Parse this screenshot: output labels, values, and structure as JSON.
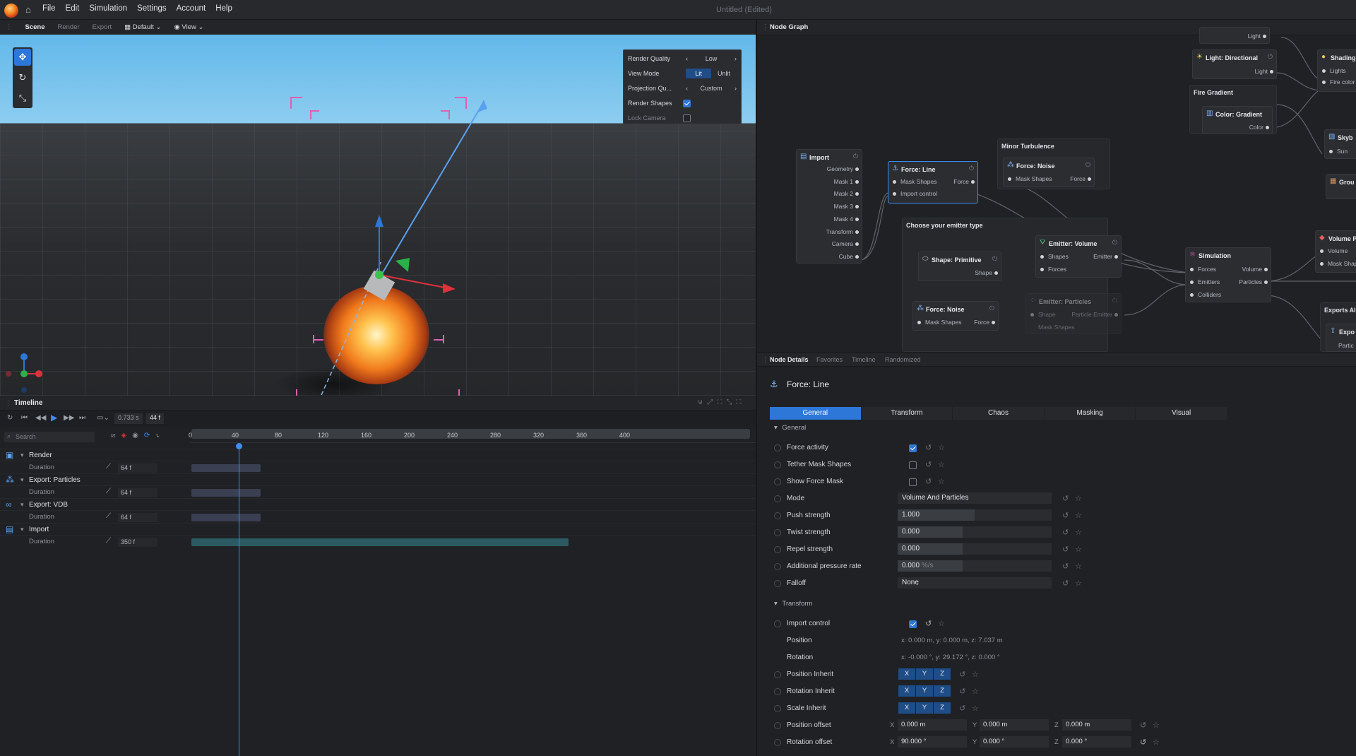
{
  "menubar": {
    "items": [
      "File",
      "Edit",
      "Simulation",
      "Settings",
      "Account",
      "Help"
    ],
    "title": "Untitled (Edited)"
  },
  "scenebar": {
    "tabs": [
      "Scene",
      "Render",
      "Export"
    ],
    "layout": "Default",
    "view": "View"
  },
  "render_panel": {
    "quality_label": "Render Quality",
    "quality_value": "Low",
    "viewmode_label": "View Mode",
    "viewmode_options": [
      "Lit",
      "Unlit"
    ],
    "viewmode_selected": "Lit",
    "projection_label": "Projection Qu...",
    "projection_value": "Custom",
    "shapes_label": "Render Shapes",
    "shapes_checked": true,
    "lock_label": "Lock Camera",
    "lock_checked": false
  },
  "timeline": {
    "title": "Timeline",
    "time": "0.733 s",
    "frame": "44 f",
    "search_placeholder": "Search",
    "ruler": [
      "0",
      "40",
      "80",
      "120",
      "160",
      "200",
      "240",
      "280",
      "320",
      "360",
      "400"
    ],
    "playhead_frame": 44,
    "tracks": [
      {
        "name": "Render",
        "sub": "Duration",
        "value": "64 f",
        "frames": 64
      },
      {
        "name": "Export: Particles",
        "sub": "Duration",
        "value": "64 f",
        "frames": 64
      },
      {
        "name": "Export: VDB",
        "sub": "Duration",
        "value": "64 f",
        "frames": 64
      },
      {
        "name": "Import",
        "sub": "Duration",
        "value": "350 f",
        "frames": 350
      }
    ]
  },
  "nodegraph": {
    "title": "Node Graph",
    "nodes": {
      "import": {
        "title": "Import",
        "pins": [
          "Geometry",
          "Mask 1",
          "Mask 2",
          "Mask 3",
          "Mask 4",
          "Transform",
          "Camera",
          "Cube"
        ]
      },
      "force_line": {
        "title": "Force: Line",
        "in1": "Mask Shapes",
        "out1": "Force",
        "in2": "Import control"
      },
      "minor_turbulence": {
        "title": "Minor Turbulence"
      },
      "force_noise_a": {
        "title": "Force: Noise",
        "in1": "Mask Shapes",
        "out1": "Force"
      },
      "emitter_group": {
        "title": "Choose your emitter type"
      },
      "shape_primitive": {
        "title": "Shape: Primitive",
        "out1": "Shape"
      },
      "emitter_volume": {
        "title": "Emitter: Volume",
        "in1": "Shapes",
        "out1": "Emitter",
        "in2": "Forces"
      },
      "force_noise_b": {
        "title": "Force: Noise",
        "in1": "Mask Shapes",
        "out1": "Force"
      },
      "emitter_particles": {
        "title": "Emitter: Particles",
        "in1": "Shape",
        "out1": "Particle Emitter",
        "in2": "Mask Shapes"
      },
      "simulation": {
        "title": "Simulation",
        "in": [
          "Forces",
          "Emitters",
          "Colliders"
        ],
        "out": [
          "Volume",
          "Particles"
        ]
      },
      "light_top": {
        "out1": "Light"
      },
      "light_dir": {
        "title": "Light: Directional",
        "out1": "Light"
      },
      "fire_gradient": {
        "title": "Fire Gradient"
      },
      "color_gradient": {
        "title": "Color: Gradient",
        "out1": "Color"
      },
      "shading": {
        "title": "Shading",
        "in": [
          "Lights",
          "Fire color"
        ]
      },
      "skybox": {
        "title": "Skyb",
        "in1": "Sun"
      },
      "ground": {
        "title": "Grou"
      },
      "volume": {
        "title": "Volume P",
        "in": [
          "Volume",
          "Mask Shap"
        ]
      },
      "exports": {
        "title": "Exports Ale",
        "node": "Expo",
        "in1": "Partic"
      }
    }
  },
  "details": {
    "tabs": [
      "Node Details",
      "Favorites",
      "Timeline",
      "Randomized"
    ],
    "node_title": "Force: Line",
    "prop_tabs": [
      "General",
      "Transform",
      "Chaos",
      "Masking",
      "Visual"
    ],
    "general_title": "General",
    "transform_title": "Transform",
    "force_activity": {
      "label": "Force activity",
      "checked": true
    },
    "tether": {
      "label": "Tether Mask Shapes",
      "checked": false
    },
    "show_mask": {
      "label": "Show Force Mask",
      "checked": false
    },
    "mode": {
      "label": "Mode",
      "value": "Volume And Particles"
    },
    "push": {
      "label": "Push strength",
      "value": "1.000",
      "fill": 0.5
    },
    "twist": {
      "label": "Twist strength",
      "value": "0.000",
      "fill": 0.42
    },
    "repel": {
      "label": "Repel strength",
      "value": "0.000",
      "fill": 0.42
    },
    "pressure": {
      "label": "Additional pressure rate",
      "value": "0.000",
      "unit": "%/s",
      "fill": 0.42
    },
    "falloff": {
      "label": "Falloff",
      "value": "None"
    },
    "import_control": {
      "label": "Import control",
      "checked": true
    },
    "position": {
      "label": "Position",
      "value": "x: 0.000 m, y: 0.000 m, z: 7.037 m"
    },
    "rotation": {
      "label": "Rotation",
      "value": "x: -0.000 °, y: 29.172 °, z: 0.000 °"
    },
    "position_inherit": {
      "label": "Position Inherit"
    },
    "rotation_inherit": {
      "label": "Rotation Inherit"
    },
    "scale_inherit": {
      "label": "Scale Inherit"
    },
    "xyz": [
      "X",
      "Y",
      "Z"
    ],
    "position_offset": {
      "label": "Position offset",
      "x": "0.000 m",
      "y": "0.000 m",
      "z": "0.000 m"
    },
    "rotation_offset": {
      "label": "Rotation offset",
      "x": "90.000 °",
      "y": "0.000 °",
      "z": "0.000 °"
    }
  }
}
